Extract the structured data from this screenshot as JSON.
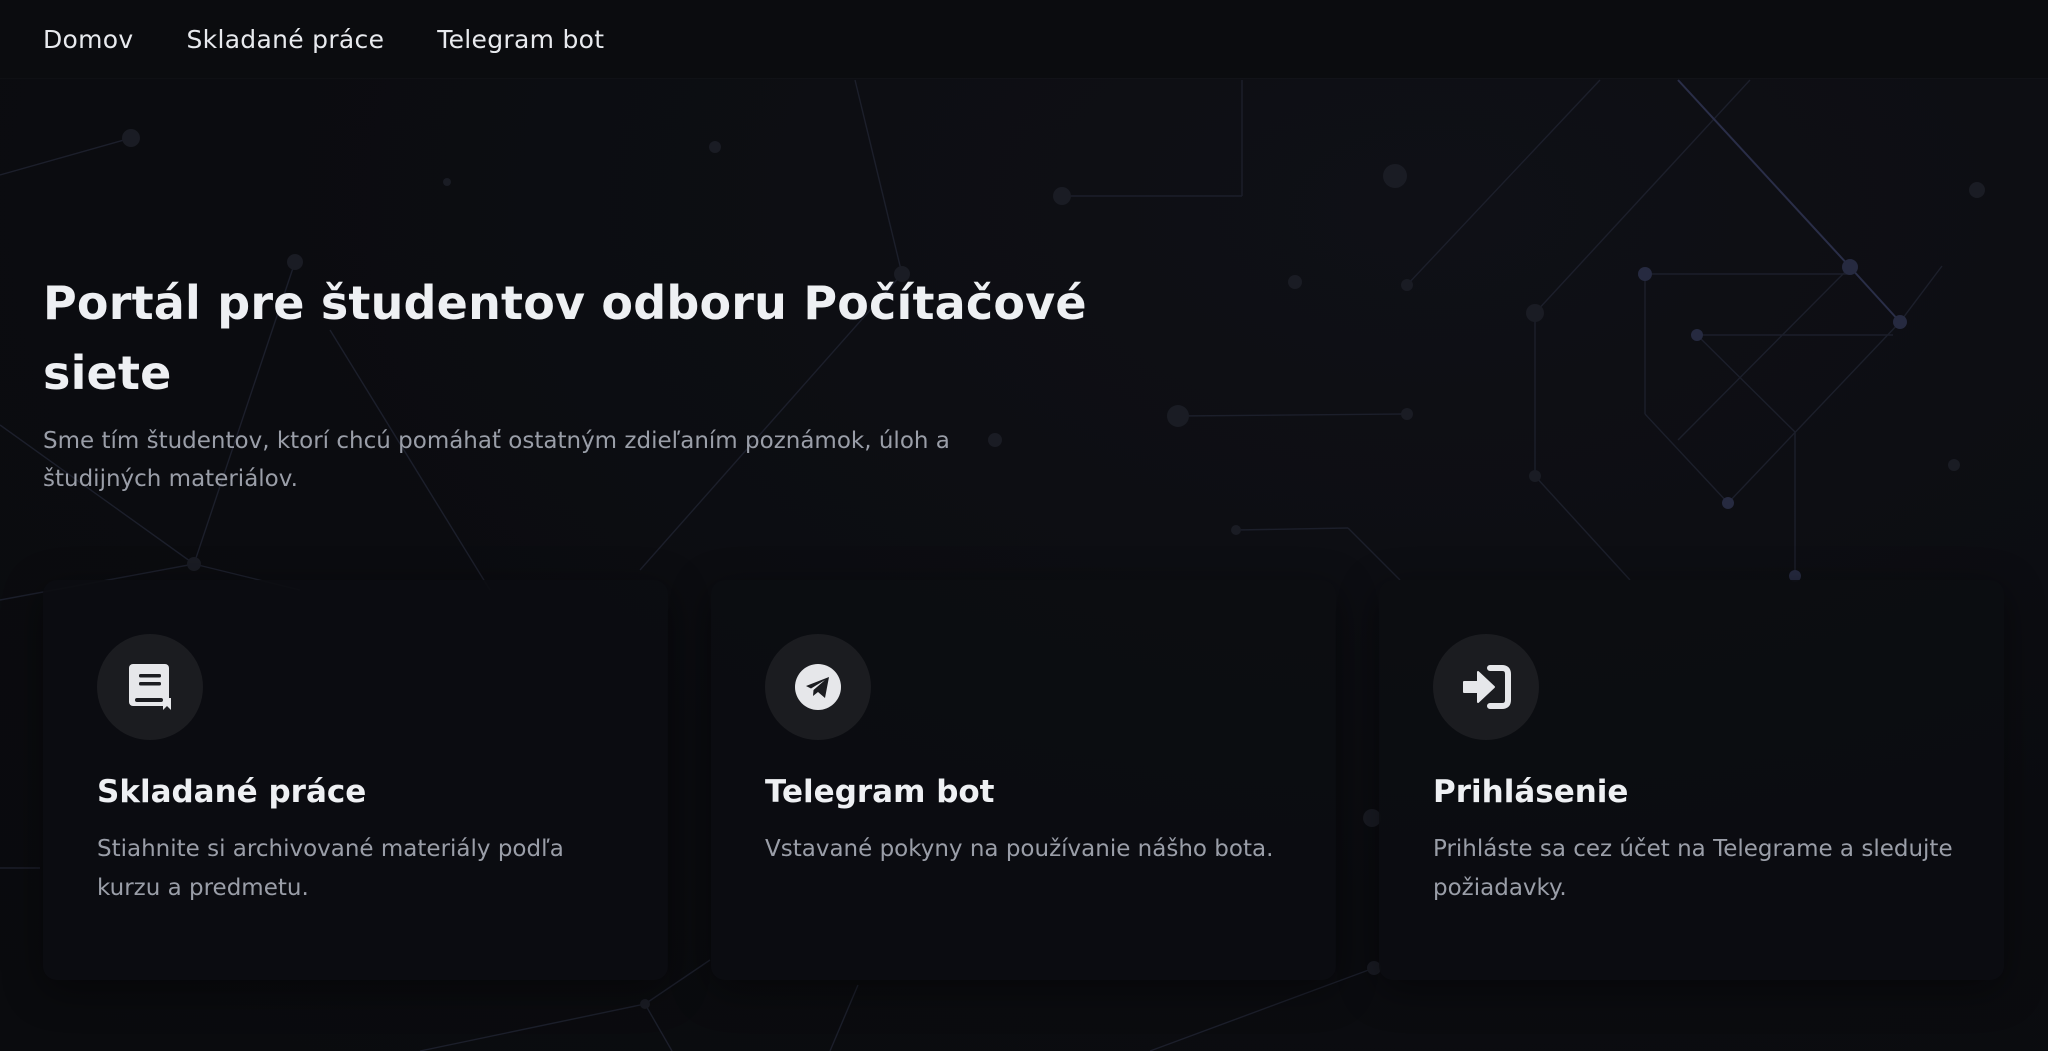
{
  "nav": {
    "items": [
      {
        "label": "Domov"
      },
      {
        "label": "Skladané práce"
      },
      {
        "label": "Telegram bot"
      }
    ]
  },
  "hero": {
    "title": "Portál pre študentov odboru Počítačové siete",
    "subtitle": "Sme tím študentov, ktorí chcú pomáhať ostatným zdieľaním poznámok, úloh a študijných materiálov."
  },
  "cards": [
    {
      "icon": "book-icon",
      "title": "Skladané práce",
      "text": "Stiahnite si archivované materiály podľa kurzu a predmetu."
    },
    {
      "icon": "telegram-icon",
      "title": "Telegram bot",
      "text": "Vstavané pokyny na používanie nášho bota."
    },
    {
      "icon": "sign-in-icon",
      "title": "Prihlásenie",
      "text": "Prihláste sa cez účet na Telegrame a sledujte požiadavky."
    }
  ],
  "colors": {
    "background": "#0c0d11",
    "card_background": "#0d0e12",
    "icon_circle": "#1b1c20",
    "text_primary": "#eef0f3",
    "text_secondary": "#9a9ea8",
    "network_line": "#2a2e48"
  }
}
